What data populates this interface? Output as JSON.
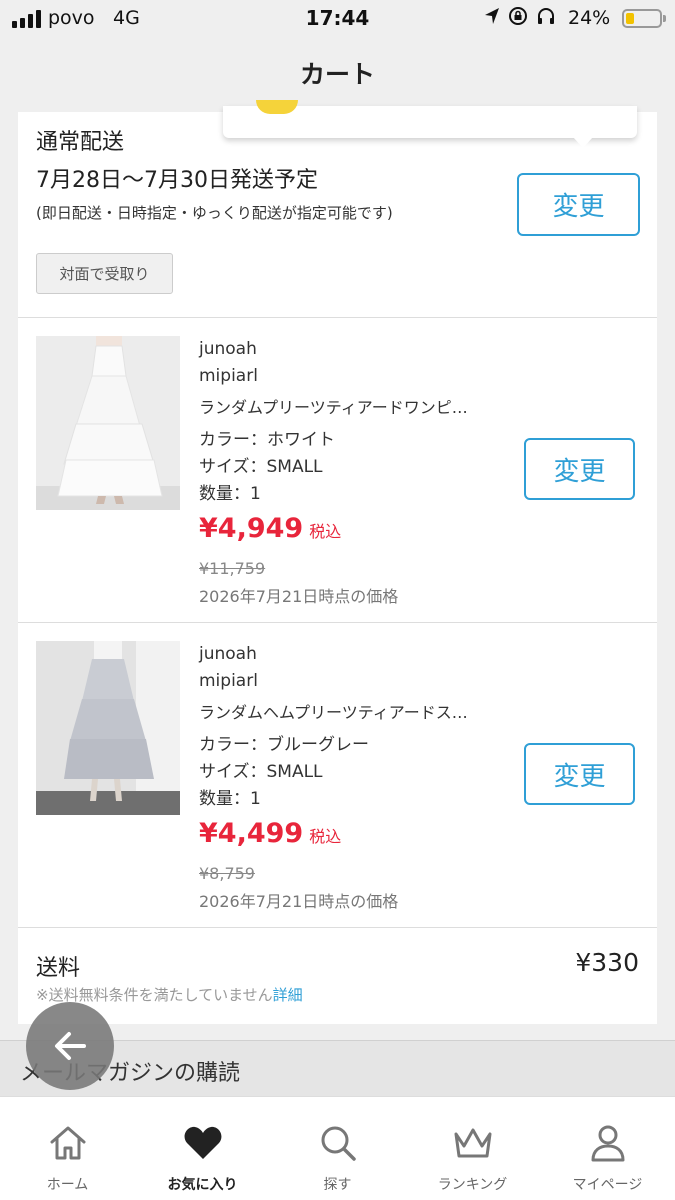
{
  "status_bar": {
    "carrier": "povo",
    "network": "4G",
    "time": "17:44",
    "battery": "24%",
    "battery_level": 0.24
  },
  "header": {
    "title": "カート"
  },
  "shipping": {
    "type": "通常配送",
    "date": "7月28日〜7月30日発送予定",
    "note": "(即日配送・日時指定・ゆっくり配送が指定可能です)",
    "face_to_face_label": "対面で受取り",
    "change_label": "変更"
  },
  "items": [
    {
      "shop": "junoah",
      "brand": "mipiarl",
      "name": "ランダムプリーツティアードワンピ…",
      "color": "カラー：ホワイト",
      "size": "サイズ：SMALL",
      "qty": "数量：1",
      "price": "¥4,949",
      "tax": "税込",
      "old_price": "¥11,759",
      "price_date": "2026年7月21日時点の価格",
      "change_label": "変更"
    },
    {
      "shop": "junoah",
      "brand": "mipiarl",
      "name": "ランダムヘムプリーツティアードス…",
      "color": "カラー：ブルーグレー",
      "size": "サイズ：SMALL",
      "qty": "数量：1",
      "price": "¥4,499",
      "tax": "税込",
      "old_price": "¥8,759",
      "price_date": "2026年7月21日時点の価格",
      "change_label": "変更"
    }
  ],
  "fee": {
    "label": "送料",
    "value": "¥330",
    "note": "※送料無料条件を満たしていません",
    "link": "詳細"
  },
  "magazine": {
    "label": "メールマガジンの購読"
  },
  "tabs": [
    {
      "label": "ホーム",
      "icon": "home-icon"
    },
    {
      "label": "お気に入り",
      "icon": "heart-icon"
    },
    {
      "label": "探す",
      "icon": "search-icon"
    },
    {
      "label": "ランキング",
      "icon": "crown-icon"
    },
    {
      "label": "マイページ",
      "icon": "user-icon"
    }
  ],
  "colors": {
    "accent": "#2f9fd6",
    "price": "#e8253b"
  }
}
